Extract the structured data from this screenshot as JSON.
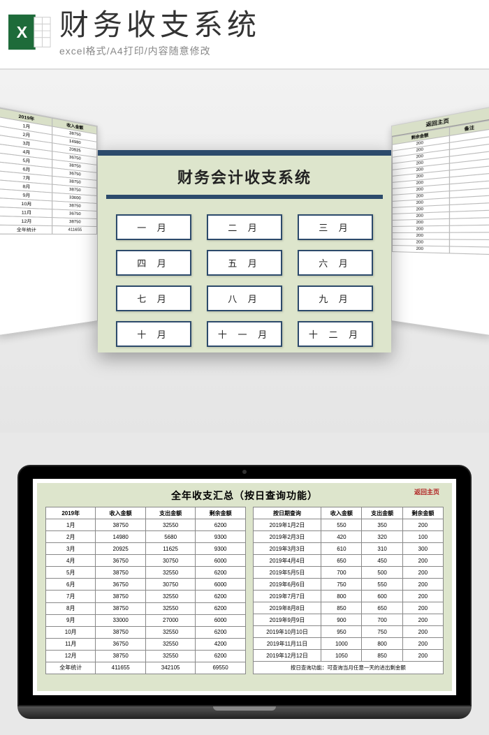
{
  "header": {
    "title": "财务收支系统",
    "subtitle": "excel格式/A4打印/内容随意修改"
  },
  "main_card": {
    "title": "财务会计收支系统",
    "months": [
      "一 月",
      "二 月",
      "三 月",
      "四 月",
      "五 月",
      "六 月",
      "七 月",
      "八 月",
      "九 月",
      "十 月",
      "十 一 月",
      "十 二 月"
    ]
  },
  "side_left": {
    "headers": [
      "2019年",
      "收入金额"
    ],
    "rows": [
      [
        "1月",
        "38750"
      ],
      [
        "2月",
        "14980"
      ],
      [
        "3月",
        "20925"
      ],
      [
        "4月",
        "36750"
      ],
      [
        "5月",
        "38750"
      ],
      [
        "6月",
        "36750"
      ],
      [
        "7月",
        "38750"
      ],
      [
        "8月",
        "38750"
      ],
      [
        "9月",
        "33000"
      ],
      [
        "10月",
        "38750"
      ],
      [
        "11月",
        "36750"
      ],
      [
        "12月",
        "38750"
      ],
      [
        "全年统计",
        "411655"
      ]
    ]
  },
  "side_right": {
    "title": "返回主页",
    "headers": [
      "剩余金额",
      "备注"
    ],
    "rows": [
      [
        "200",
        ""
      ],
      [
        "200",
        ""
      ],
      [
        "200",
        ""
      ],
      [
        "200",
        ""
      ],
      [
        "200",
        ""
      ],
      [
        "200",
        ""
      ],
      [
        "200",
        ""
      ],
      [
        "200",
        ""
      ],
      [
        "200",
        ""
      ],
      [
        "200",
        ""
      ],
      [
        "200",
        ""
      ],
      [
        "200",
        ""
      ],
      [
        "200",
        ""
      ],
      [
        "200",
        ""
      ],
      [
        "200",
        ""
      ],
      [
        "200",
        ""
      ],
      [
        "200",
        ""
      ]
    ]
  },
  "summary": {
    "title": "全年收支汇总（按日查询功能）",
    "return_label": "返回主页",
    "left_headers": [
      "2019年",
      "收入金额",
      "支出金额",
      "剩余金额"
    ],
    "left_rows": [
      [
        "1月",
        "38750",
        "32550",
        "6200"
      ],
      [
        "2月",
        "14980",
        "5680",
        "9300"
      ],
      [
        "3月",
        "20925",
        "11625",
        "9300"
      ],
      [
        "4月",
        "36750",
        "30750",
        "6000"
      ],
      [
        "5月",
        "38750",
        "32550",
        "6200"
      ],
      [
        "6月",
        "36750",
        "30750",
        "6000"
      ],
      [
        "7月",
        "38750",
        "32550",
        "6200"
      ],
      [
        "8月",
        "38750",
        "32550",
        "6200"
      ],
      [
        "9月",
        "33000",
        "27000",
        "6000"
      ],
      [
        "10月",
        "38750",
        "32550",
        "6200"
      ],
      [
        "11月",
        "36750",
        "32550",
        "4200"
      ],
      [
        "12月",
        "38750",
        "32550",
        "6200"
      ],
      [
        "全年统计",
        "411655",
        "342105",
        "69550"
      ]
    ],
    "right_headers": [
      "按日期查询",
      "收入金额",
      "支出金额",
      "剩余金额"
    ],
    "right_rows": [
      [
        "2019年1月2日",
        "550",
        "350",
        "200"
      ],
      [
        "2019年2月3日",
        "420",
        "320",
        "100"
      ],
      [
        "2019年3月3日",
        "610",
        "310",
        "300"
      ],
      [
        "2019年4月4日",
        "650",
        "450",
        "200"
      ],
      [
        "2019年5月5日",
        "700",
        "500",
        "200"
      ],
      [
        "2019年6月6日",
        "750",
        "550",
        "200"
      ],
      [
        "2019年7月7日",
        "800",
        "600",
        "200"
      ],
      [
        "2019年8月8日",
        "850",
        "650",
        "200"
      ],
      [
        "2019年9月9日",
        "900",
        "700",
        "200"
      ],
      [
        "2019年10月10日",
        "950",
        "750",
        "200"
      ],
      [
        "2019年11月11日",
        "1000",
        "800",
        "200"
      ],
      [
        "2019年12月12日",
        "1050",
        "850",
        "200"
      ]
    ],
    "footnote": "按日查询功能：可查询当月任意一天的进出剩金额"
  }
}
